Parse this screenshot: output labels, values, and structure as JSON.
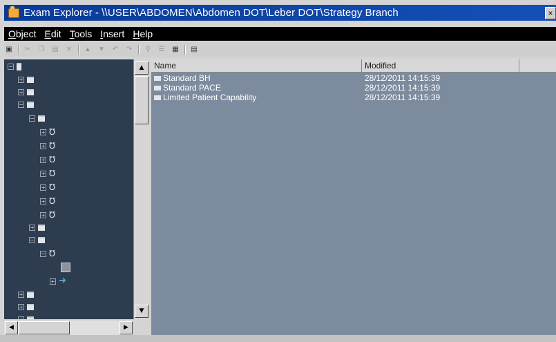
{
  "window": {
    "title": "Exam Explorer - \\\\USER\\ABDOMEN\\Abdomen DOT\\Leber DOT\\Strategy Branch",
    "close_glyph": "×"
  },
  "menu": [
    {
      "label": "Object",
      "underline": "O"
    },
    {
      "label": "Edit",
      "underline": "E"
    },
    {
      "label": "Tools",
      "underline": "T"
    },
    {
      "label": "Insert",
      "underline": "I"
    },
    {
      "label": "Help",
      "underline": "H"
    }
  ],
  "list": {
    "columns": {
      "name": "Name",
      "modified": "Modified"
    },
    "rows": [
      {
        "name": "Standard BH",
        "modified": "28/12/2011 14:15:39"
      },
      {
        "name": "Standard PACE",
        "modified": "28/12/2011 14:15:39"
      },
      {
        "name": "Limited Patient Capability",
        "modified": "28/12/2011 14:15:39"
      }
    ]
  },
  "tree": {
    "nodes": [
      {
        "type": "root",
        "expander": "⊟"
      },
      {
        "type": "folder",
        "expander": "⊞"
      },
      {
        "type": "folder",
        "expander": "⊞"
      },
      {
        "type": "folder",
        "expander": "⊟"
      },
      {
        "type": "folder",
        "expander": "⊟"
      },
      {
        "type": "stethoscope",
        "expander": "⊞"
      },
      {
        "type": "stethoscope",
        "expander": "⊞"
      },
      {
        "type": "stethoscope",
        "expander": "⊞"
      },
      {
        "type": "stethoscope",
        "expander": "⊞"
      },
      {
        "type": "stethoscope",
        "expander": "⊞"
      },
      {
        "type": "stethoscope",
        "expander": "⊞"
      },
      {
        "type": "stethoscope",
        "expander": "⊞"
      },
      {
        "type": "folder",
        "expander": "⊞"
      },
      {
        "type": "folder",
        "expander": "⊟"
      },
      {
        "type": "stethoscope",
        "expander": "⊟"
      },
      {
        "type": "document",
        "expander": ""
      },
      {
        "type": "arrow",
        "expander": "⊞"
      },
      {
        "type": "folder",
        "expander": "⊞"
      },
      {
        "type": "folder",
        "expander": "⊞"
      },
      {
        "type": "folder",
        "expander": "⊞"
      }
    ]
  },
  "colors": {
    "title_bar": "#0a3a96",
    "menu_bar": "#000000",
    "tree_bg": "#2e3c50",
    "list_bg": "#7d8b9e"
  },
  "icons": {
    "stethoscope": "stethoscope-icon",
    "folder": "folder-icon",
    "document": "document-icon",
    "arrow": "arrow-icon"
  }
}
